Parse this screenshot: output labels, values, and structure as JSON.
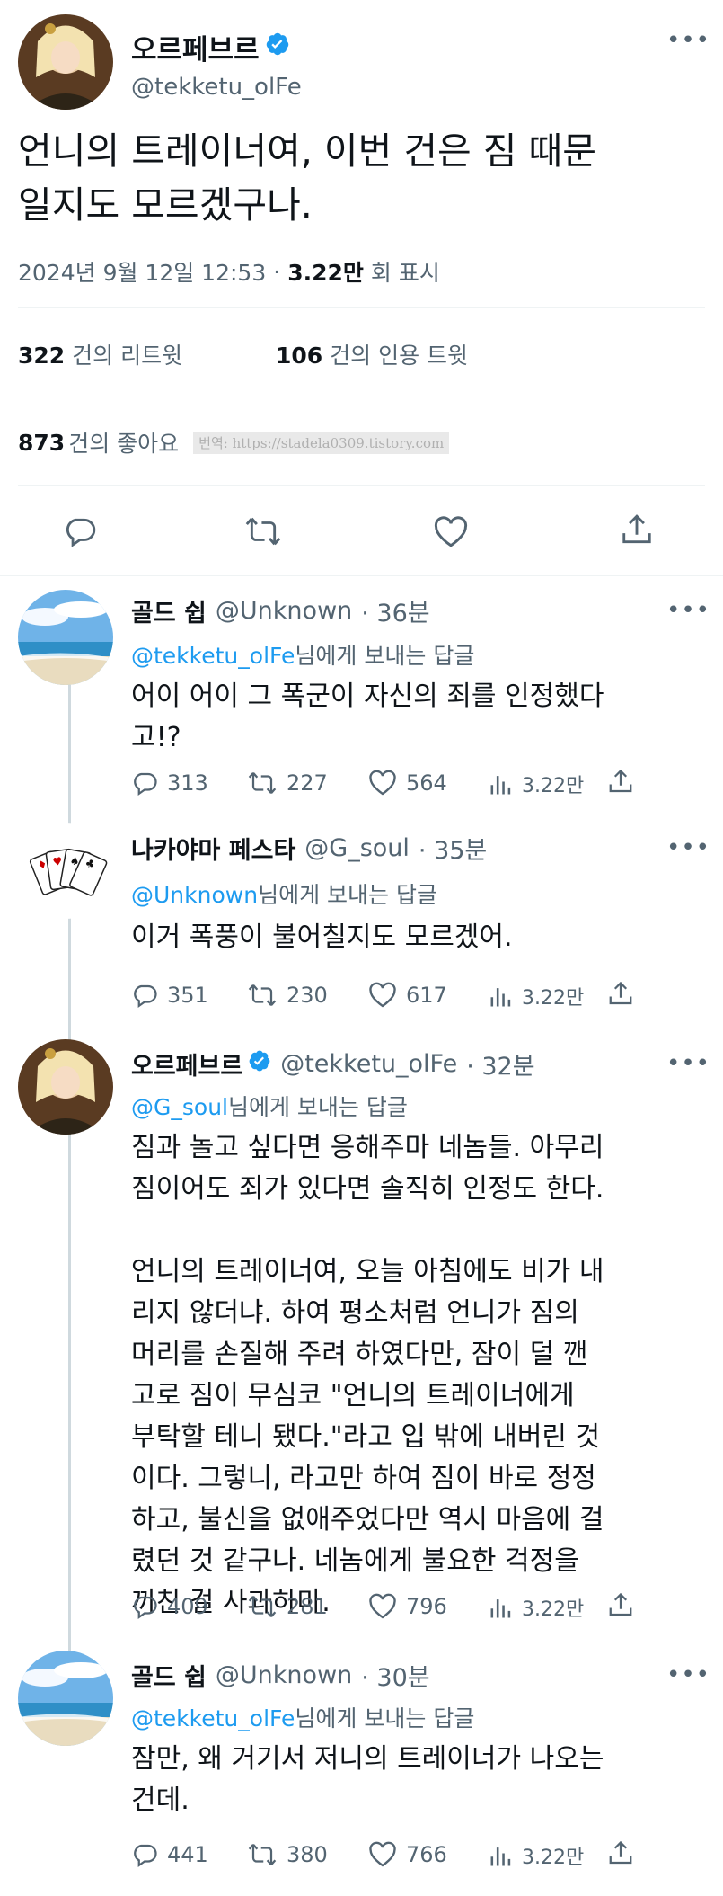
{
  "main_tweet": {
    "display_name": "오르페브르",
    "handle": "@tekketu_olFe",
    "text_line1": "언니의 트레이너여, 이번 건은 짐 때문",
    "text_line2": "일지도 모르겠구나.",
    "date": "2024년 9월 12일  12:53",
    "sep": "·",
    "views_count": "3.22만",
    "views_label": "회 표시",
    "retweets_count": "322",
    "retweets_label": "건의 리트윗",
    "quotes_count": "106",
    "quotes_label": "건의 인용 트윗",
    "likes_count": "873",
    "likes_label": "건의 좋아요",
    "watermark": "번역: https://stadela0309.tistory.com"
  },
  "replies": [
    {
      "display_name": "골드 쉽",
      "handle": "@Unknown",
      "time": "· 36분",
      "reply_to_handle": "@tekketu_olFe",
      "reply_to_suffix": "님에게 보내는 답글",
      "lines": [
        "어이 어이 그 폭군이 자신의 죄를 인정했다",
        "고!?"
      ],
      "replies": "313",
      "retweets": "227",
      "likes": "564",
      "views": "3.22만"
    },
    {
      "display_name": "나카야마 페스타",
      "handle": "@G_soul",
      "time": "· 35분",
      "reply_to_handle": "@Unknown",
      "reply_to_suffix": "님에게 보내는 답글",
      "lines": [
        "이거 폭풍이 불어칠지도 모르겠어."
      ],
      "replies": "351",
      "retweets": "230",
      "likes": "617",
      "views": "3.22만"
    },
    {
      "display_name": "오르페브르",
      "handle": "@tekketu_olFe",
      "time": "· 32분",
      "reply_to_handle": "@G_soul",
      "reply_to_suffix": "님에게 보내는 답글",
      "lines": [
        "짐과 놀고 싶다면 응해주마 네놈들. 아무리",
        "짐이어도 죄가 있다면 솔직히 인정도 한다.",
        "",
        "언니의 트레이너여, 오늘 아침에도 비가 내",
        "리지 않더냐. 하여 평소처럼 언니가 짐의",
        "머리를 손질해 주려 하였다만, 잠이 덜 깬",
        "고로 짐이 무심코 \"언니의 트레이너에게",
        "부탁할 테니 됐다.\"라고 입 밖에 내버린 것",
        "이다. 그렇니, 라고만 하여 짐이 바로 정정",
        "하고, 불신을 없애주었다만 역시 마음에 걸",
        "렸던 것 같구나. 네놈에게 불요한 걱정을",
        "끼친 걸 사과하마."
      ],
      "replies": "409",
      "retweets": "281",
      "likes": "796",
      "views": "3.22만"
    },
    {
      "display_name": "골드 쉽",
      "handle": "@Unknown",
      "time": "· 30분",
      "reply_to_handle": "@tekketu_olFe",
      "reply_to_suffix": "님에게 보내는 답글",
      "lines": [
        "잠만, 왜 거기서 저니의 트레이너가 나오는",
        "건데."
      ],
      "replies": "441",
      "retweets": "380",
      "likes": "766",
      "views": "3.22만"
    }
  ],
  "colors": {
    "text": "#0f1419",
    "secondary": "#536471",
    "link": "#1d9bf0",
    "divider": "#eff3f4",
    "thread_line": "#cfd9de"
  }
}
